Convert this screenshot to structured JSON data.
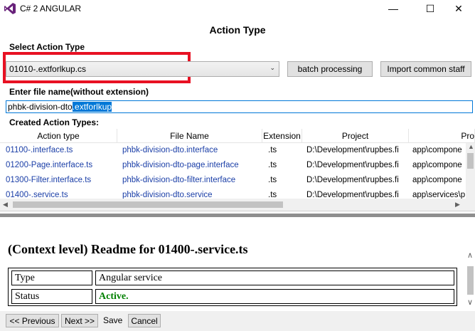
{
  "window": {
    "title": "C# 2 ANGULAR",
    "minimize_glyph": "—",
    "maximize_glyph": "☐",
    "close_glyph": "✕"
  },
  "heading": "Action Type",
  "select_action": {
    "label": "Select Action Type",
    "value": "01010-.extforlkup.cs",
    "dropdown_glyph": "⌄"
  },
  "buttons": {
    "batch": "batch processing",
    "import": "Import common staff"
  },
  "file_name": {
    "label": "Enter file name(without extension)",
    "prefix": "phbk-division-dto",
    "selected": ".extforlkup"
  },
  "created": {
    "label": "Created Action Types:",
    "columns": [
      "Action type",
      "File Name",
      "Extension",
      "Project",
      "Pro"
    ],
    "rows": [
      {
        "action": "01100-.interface.ts",
        "file": "phbk-division-dto.interface",
        "ext": ".ts",
        "project": "D:\\Development\\rupbes.fi",
        "path": "app\\compone"
      },
      {
        "action": "01200-Page.interface.ts",
        "file": "phbk-division-dto-page.interface",
        "ext": ".ts",
        "project": "D:\\Development\\rupbes.fi",
        "path": "app\\compone"
      },
      {
        "action": "01300-Filter.interface.ts",
        "file": "phbk-division-dto-filter.interface",
        "ext": ".ts",
        "project": "D:\\Development\\rupbes.fi",
        "path": "app\\compone"
      },
      {
        "action": "01400-.service.ts",
        "file": "phbk-division-dto.service",
        "ext": ".ts",
        "project": "D:\\Development\\rupbes.fi",
        "path": "app\\services\\p"
      }
    ]
  },
  "readme": {
    "title": "(Context level) Readme for 01400-.service.ts",
    "rows": [
      {
        "key": "Type",
        "value": "Angular service"
      },
      {
        "key": "Status",
        "value": "Active."
      }
    ],
    "status_color": "#008000"
  },
  "footer": {
    "previous": "<< Previous",
    "next": "Next >>",
    "save": "Save",
    "cancel": "Cancel"
  },
  "colors": {
    "highlight": "#e81123",
    "selection": "#0078d7",
    "link_text": "#1a3ea7"
  }
}
